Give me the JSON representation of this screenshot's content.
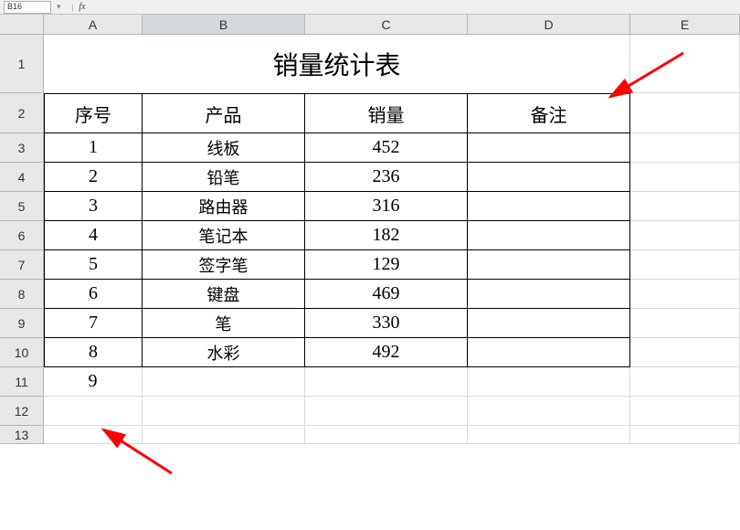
{
  "name_box": "B16",
  "fx_label": "fx",
  "columns": [
    "A",
    "B",
    "C",
    "D",
    "E"
  ],
  "rows": [
    "1",
    "2",
    "3",
    "4",
    "5",
    "6",
    "7",
    "8",
    "9",
    "10",
    "11",
    "12",
    "13"
  ],
  "title": "销量统计表",
  "headers": {
    "seq": "序号",
    "product": "产品",
    "sales": "销量",
    "remark": "备注"
  },
  "chart_data": {
    "type": "table",
    "title": "销量统计表",
    "columns": [
      "序号",
      "产品",
      "销量",
      "备注"
    ],
    "rows": [
      {
        "seq": "1",
        "product": "线板",
        "sales": "452",
        "remark": ""
      },
      {
        "seq": "2",
        "product": "铅笔",
        "sales": "236",
        "remark": ""
      },
      {
        "seq": "3",
        "product": "路由器",
        "sales": "316",
        "remark": ""
      },
      {
        "seq": "4",
        "product": "笔记本",
        "sales": "182",
        "remark": ""
      },
      {
        "seq": "5",
        "product": "签字笔",
        "sales": "129",
        "remark": ""
      },
      {
        "seq": "6",
        "product": "键盘",
        "sales": "469",
        "remark": ""
      },
      {
        "seq": "7",
        "product": "笔",
        "sales": "330",
        "remark": ""
      },
      {
        "seq": "8",
        "product": "水彩",
        "sales": "492",
        "remark": ""
      }
    ]
  },
  "extra_seq": "9",
  "selected_column": "B",
  "annotations": {
    "arrow_color": "#ff0000"
  }
}
